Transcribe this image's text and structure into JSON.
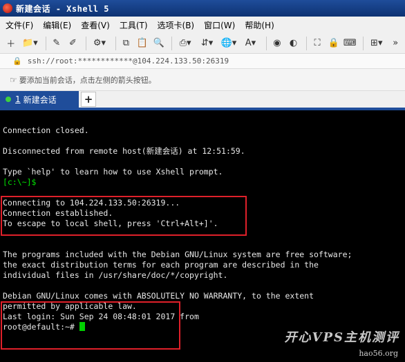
{
  "window": {
    "title": "新建会话 - Xshell 5"
  },
  "menu": [
    "文件(F)",
    "编辑(E)",
    "查看(V)",
    "工具(T)",
    "选项卡(B)",
    "窗口(W)",
    "帮助(H)"
  ],
  "address": {
    "text": "ssh://root:************@104.224.133.50:26319"
  },
  "hint": {
    "text": "要添加当前会话，点击左侧的箭头按钮。"
  },
  "tabs": [
    {
      "number": "1",
      "label": "新建会话",
      "status_color": "#3fd13f"
    }
  ],
  "tab_add_label": "+",
  "terminal": {
    "lines": [
      "Connection closed.",
      "",
      "Disconnected from remote host(新建会话) at 12:51:59.",
      "",
      "Type `help' to learn how to use Xshell prompt.",
      "[c:\\~]$",
      "",
      "Connecting to 104.224.133.50:26319...",
      "Connection established.",
      "To escape to local shell, press 'Ctrl+Alt+]'.",
      "",
      "",
      "The programs included with the Debian GNU/Linux system are free software;",
      "the exact distribution terms for each program are described in the",
      "individual files in /usr/share/doc/*/copyright.",
      "",
      "Debian GNU/Linux comes with ABSOLUTELY NO WARRANTY, to the extent",
      "permitted by applicable law.",
      "Last login: Sun Sep 24 08:48:01 2017 from",
      "root@default:~# "
    ]
  },
  "watermark": {
    "main": "开心VPS主机测评",
    "sub": "hao56.org"
  },
  "colors": {
    "accent": "#1f4d9a",
    "terminal_bg": "#000000",
    "highlight": "#e0202a",
    "prompt": "#00e000"
  }
}
